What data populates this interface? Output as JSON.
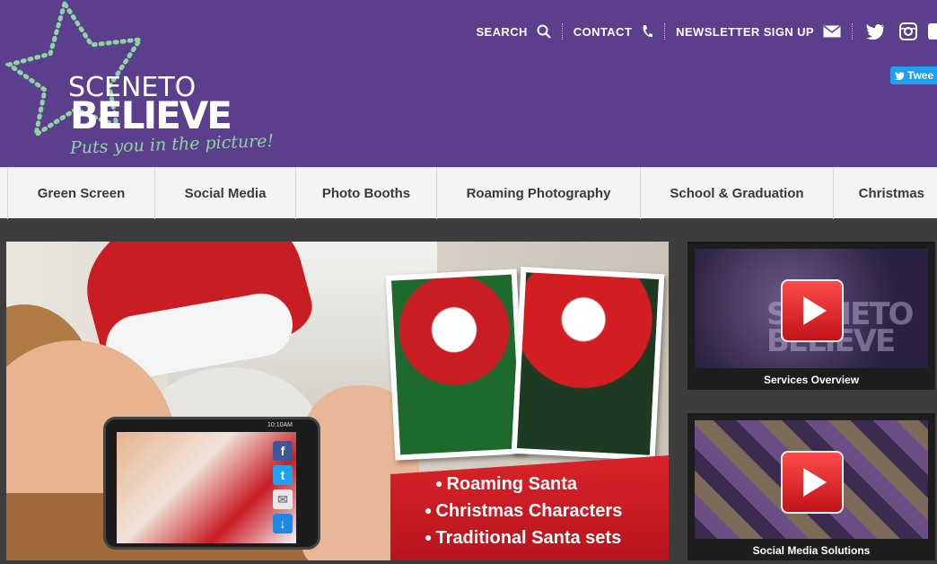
{
  "header": {
    "logo": {
      "line1": "SCENE",
      "line1_to": "TO",
      "line2": "BELIEVE",
      "tagline": "Puts you in the picture!"
    },
    "topnav": [
      {
        "label": "SEARCH",
        "icon": "search-icon"
      },
      {
        "label": "CONTACT",
        "icon": "phone-icon"
      },
      {
        "label": "NEWSLETTER SIGN UP",
        "icon": "mail-icon"
      }
    ],
    "social": [
      "twitter-icon",
      "instagram-icon"
    ],
    "tweet_label": "Twee"
  },
  "mainnav": {
    "tabs": [
      "Green Screen",
      "Social Media",
      "Photo Booths",
      "Roaming Photography",
      "School & Graduation",
      "Christmas"
    ]
  },
  "hero": {
    "bullets": [
      "Roaming Santa",
      "Christmas Characters",
      "Traditional Santa sets"
    ],
    "phone_time": "10:10AM"
  },
  "videos": [
    {
      "caption": "Services Overview"
    },
    {
      "caption": "Social Media Solutions"
    }
  ],
  "colors": {
    "header_bg": "#5b3f8c",
    "tagline": "#8fd3a2",
    "banner_red": "#d9232a",
    "nav_bg": "#f4f4f4"
  }
}
